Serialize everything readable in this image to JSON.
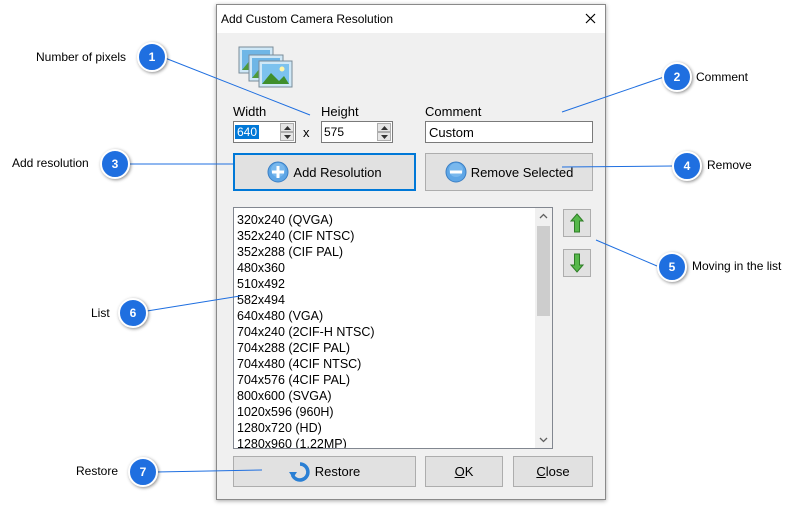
{
  "dialog": {
    "title": "Add Custom Camera Resolution",
    "width_label": "Width",
    "height_label": "Height",
    "width_value": "640",
    "height_value": "575",
    "times_sign": "x",
    "comment_label": "Comment",
    "comment_value": "Custom",
    "add_button": "Add Resolution",
    "remove_button": "Remove Selected",
    "list_items": [
      "320x240 (QVGA)",
      "352x240 (CIF NTSC)",
      "352x288 (CIF PAL)",
      "480x360",
      "510x492",
      "582x494",
      "640x480 (VGA)",
      "704x240 (2CIF-H NTSC)",
      "704x288 (2CIF PAL)",
      "704x480 (4CIF NTSC)",
      "704x576 (4CIF PAL)",
      "800x600 (SVGA)",
      "1020x596 (960H)",
      "1280x720 (HD)",
      "1280x960 (1.22MP)"
    ],
    "restore_button": "Restore",
    "ok_mnemonic": "O",
    "ok_rest": "K",
    "close_mnemonic": "C",
    "close_rest": "lose"
  },
  "callouts": [
    {
      "number": "1",
      "label": "Number of pixels"
    },
    {
      "number": "2",
      "label": "Comment"
    },
    {
      "number": "3",
      "label": "Add resolution"
    },
    {
      "number": "4",
      "label": "Remove"
    },
    {
      "number": "5",
      "label": "Moving in the list"
    },
    {
      "number": "6",
      "label": "List"
    },
    {
      "number": "7",
      "label": "Restore"
    }
  ],
  "colors": {
    "callout": "#1f6fe0",
    "focus": "#0078d7",
    "arrow_green": "#4caf50"
  }
}
